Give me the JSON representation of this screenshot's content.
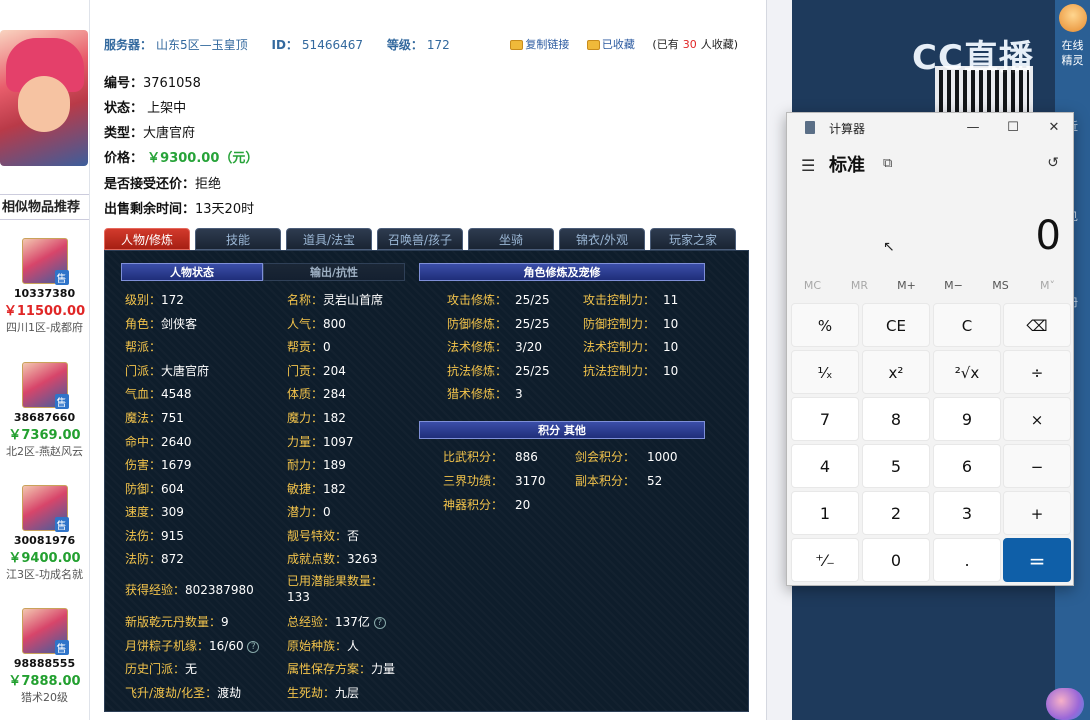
{
  "header": {
    "server_label": "服务器：",
    "server_value": "山东5区—玉皇顶",
    "id_label": "ID：",
    "id_value": "51466467",
    "level_label": "等级：",
    "level_value": "172",
    "copy_link": "复制链接",
    "favorited": "已收藏",
    "fav_count_prefix": "(已有",
    "fav_count": "30",
    "fav_count_suffix": "人收藏)"
  },
  "info": {
    "number_label": "编号：",
    "number_value": "3761058",
    "status_label": "状态：",
    "status_value": "上架中",
    "type_label": "类型：",
    "type_value": "大唐官府",
    "price_label": "价格：",
    "price_value": "￥9300.00（元）",
    "bargain_label": "是否接受还价：",
    "bargain_value": "拒绝",
    "remaining_label": "出售剩余时间：",
    "remaining_value": "13天20时"
  },
  "similar": {
    "title": "相似物品推荐",
    "items": [
      {
        "id": "10337380",
        "price": "￥11500.00",
        "server": "四川1区-成都府",
        "price_color": "#e02626",
        "tag": "售"
      },
      {
        "id": "38687660",
        "price": "￥7369.00",
        "server": "北2区-燕赵风云",
        "price_color": "#23a030",
        "tag": "售"
      },
      {
        "id": "30081976",
        "price": "￥9400.00",
        "server": "江3区-功成名就",
        "price_color": "#23a030",
        "tag": "售"
      },
      {
        "id": "98888555",
        "price": "￥7888.00",
        "server": "猎术20级",
        "price_color": "#23a030",
        "tag": "售"
      }
    ]
  },
  "tabs": [
    "人物/修炼",
    "技能",
    "道具/法宝",
    "召唤兽/孩子",
    "坐骑",
    "锦衣/外观",
    "玩家之家"
  ],
  "panel": {
    "band_status": "人物状态",
    "band_output": "输出/抗性",
    "band_cultivation": "角色修炼及宠修",
    "band_points": "积分 其他",
    "col1": [
      {
        "k": "级别：",
        "v": "172"
      },
      {
        "k": "角色：",
        "v": "剑侠客"
      },
      {
        "k": "帮派：",
        "v": ""
      },
      {
        "k": "门派：",
        "v": "大唐官府"
      },
      {
        "k": "气血：",
        "v": "4548"
      },
      {
        "k": "魔法：",
        "v": "751"
      },
      {
        "k": "命中：",
        "v": "2640"
      },
      {
        "k": "伤害：",
        "v": "1679"
      },
      {
        "k": "防御：",
        "v": "604"
      },
      {
        "k": "速度：",
        "v": "309"
      },
      {
        "k": "法伤：",
        "v": "915"
      },
      {
        "k": "法防：",
        "v": "872"
      }
    ],
    "col2": [
      {
        "k": "名称：",
        "v": "灵岩山首席"
      },
      {
        "k": "人气：",
        "v": "800"
      },
      {
        "k": "帮贡：",
        "v": "0"
      },
      {
        "k": "门贡：",
        "v": "204"
      },
      {
        "k": "体质：",
        "v": "284"
      },
      {
        "k": "魔力：",
        "v": "182"
      },
      {
        "k": "力量：",
        "v": "1097"
      },
      {
        "k": "耐力：",
        "v": "189"
      },
      {
        "k": "敏捷：",
        "v": "182"
      },
      {
        "k": "潜力：",
        "v": "0"
      },
      {
        "k": "靓号特效：",
        "v": "否"
      },
      {
        "k": "成就点数：",
        "v": "3263"
      }
    ],
    "extra_left": [
      {
        "k": "获得经验：",
        "v": "802387980"
      },
      {
        "k": "新版乾元丹数量：",
        "v": "9"
      },
      {
        "k": "月饼粽子机缘：",
        "v": "16/60"
      },
      {
        "k": "历史门派：",
        "v": "无"
      },
      {
        "k": "飞升/渡劫/化圣：",
        "v": "渡劫"
      }
    ],
    "extra_right": [
      {
        "k": "已用潜能果数量：",
        "v": "133"
      },
      {
        "k": "总经验：",
        "v": "137亿"
      },
      {
        "k": "原始种族：",
        "v": "人"
      },
      {
        "k": "属性保存方案：",
        "v": "力量"
      },
      {
        "k": "生死劫：",
        "v": "九层"
      }
    ],
    "cultivation": [
      {
        "k": "攻击修炼：",
        "v": "25/25",
        "k2": "攻击控制力：",
        "v2": "11"
      },
      {
        "k": "防御修炼：",
        "v": "25/25",
        "k2": "防御控制力：",
        "v2": "10"
      },
      {
        "k": "法术修炼：",
        "v": "3/20",
        "k2": "法术控制力：",
        "v2": "10"
      },
      {
        "k": "抗法修炼：",
        "v": "25/25",
        "k2": "抗法控制力：",
        "v2": "10"
      },
      {
        "k": "猎术修炼：",
        "v": "3",
        "k2": "",
        "v2": ""
      }
    ],
    "points": [
      {
        "k": "比武积分：",
        "v": "886",
        "k2": "剑会积分：",
        "v2": "1000"
      },
      {
        "k": "三界功绩：",
        "v": "3170",
        "k2": "副本积分：",
        "v2": "52"
      },
      {
        "k": "神器积分：",
        "v": "20",
        "k2": "",
        "v2": ""
      }
    ]
  },
  "stream": {
    "logo": "CC直播",
    "right_label": "在线精灵",
    "right_items": [
      "近",
      "见",
      "册"
    ]
  },
  "calculator": {
    "title": "计算器",
    "mode": "标准",
    "display": "0",
    "memory": [
      "MC",
      "MR",
      "M+",
      "M−",
      "MS",
      "M˅"
    ],
    "keys": [
      [
        "%",
        "CE",
        "C",
        "⌫"
      ],
      [
        "¹⁄ₓ",
        "x²",
        "²√x",
        "÷"
      ],
      [
        "7",
        "8",
        "9",
        "×"
      ],
      [
        "4",
        "5",
        "6",
        "−"
      ],
      [
        "1",
        "2",
        "3",
        "+"
      ],
      [
        "⁺⁄₋",
        "0",
        ".",
        "="
      ]
    ]
  }
}
